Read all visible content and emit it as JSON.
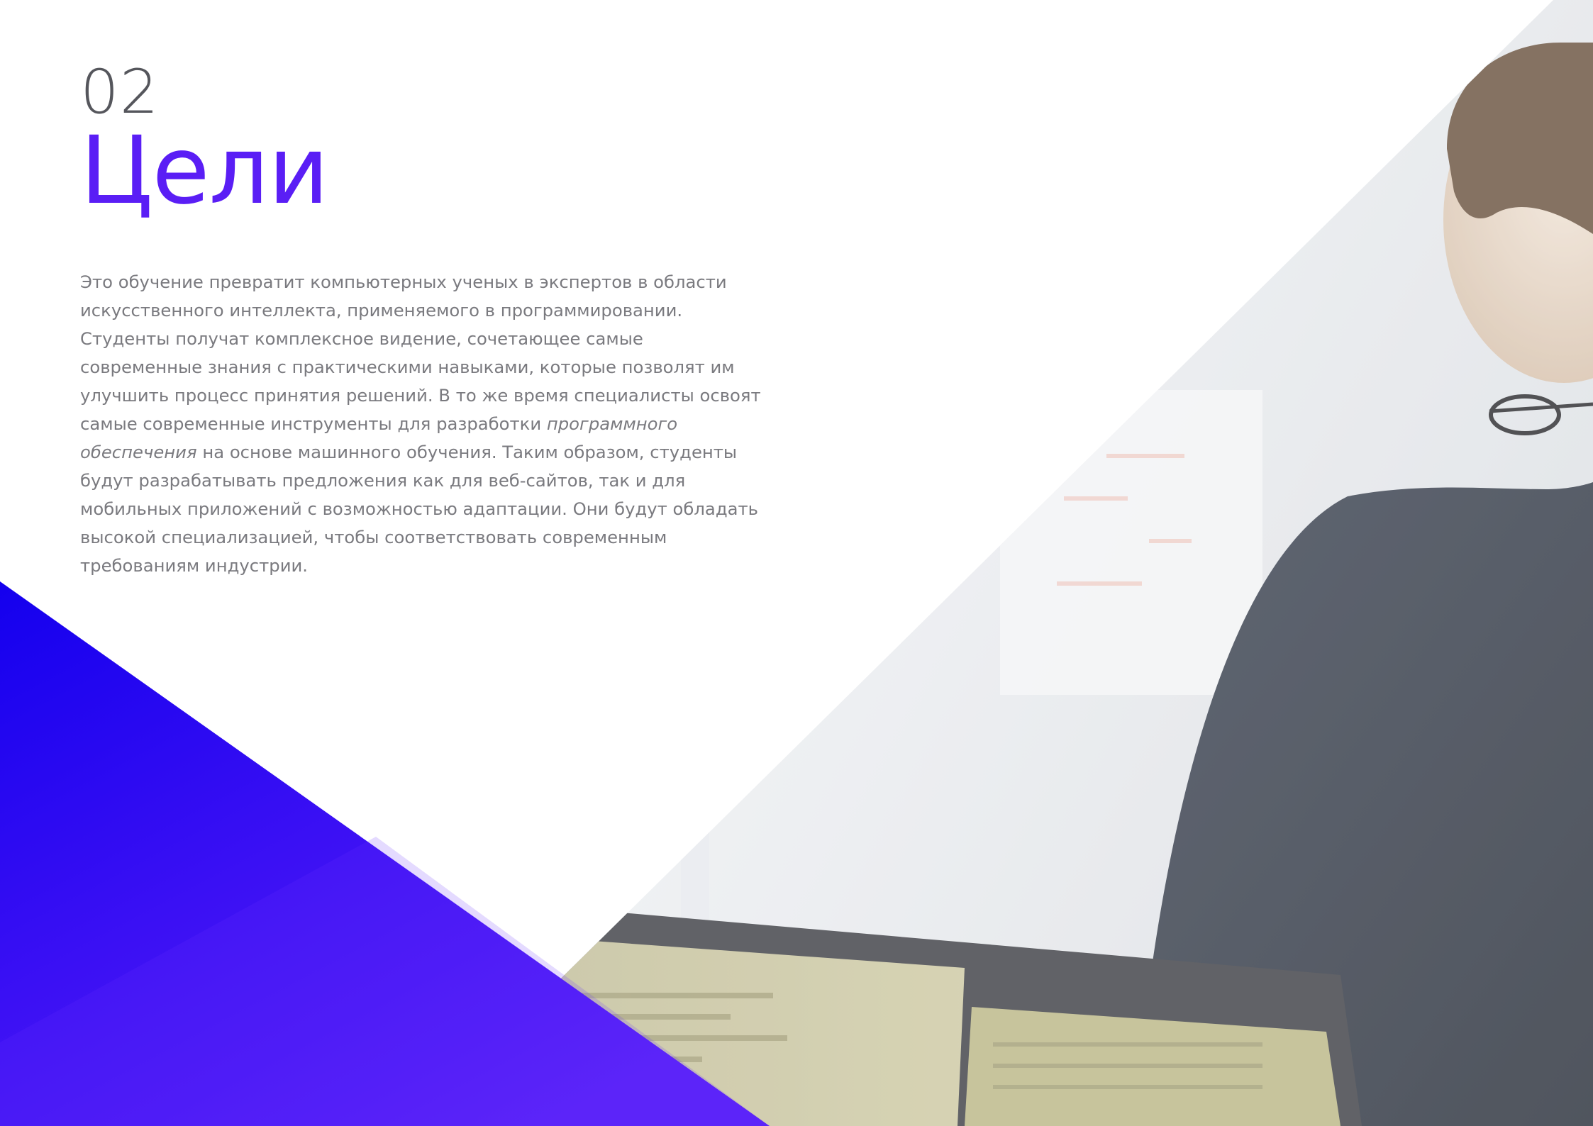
{
  "section": {
    "number": "02",
    "title": "Цели"
  },
  "body": {
    "text_1": "Это обучение превратит компьютерных ученых в экспертов в области искусственного интеллекта, применяемого в программировании. Студенты получат комплексное видение, сочетающее самые современные знания с практическими навыками, которые позволят им улучшить процесс принятия решений. В то же время специалисты освоят самые современные инструменты для разработки ",
    "emphasis": "программного обеспечения",
    "text_2": " на основе машинного обучения. Таким образом, студенты будут разрабатывать предложения как для веб-сайтов, так и для мобильных приложений с возможностью адаптации. Они будут обладать высокой специализацией, чтобы соответствовать современным требованиям индустрии."
  },
  "colors": {
    "accent": "#5a1ef5",
    "accent_deep": "#1a00e8",
    "number_gray": "#55565c",
    "body_gray": "#7a7a7f"
  }
}
